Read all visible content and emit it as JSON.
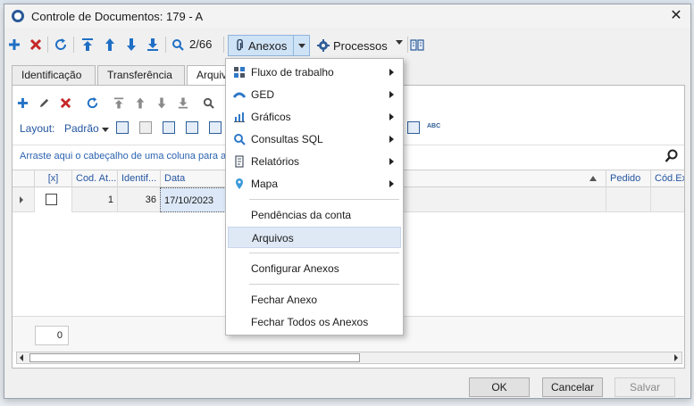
{
  "window": {
    "title": "Controle de Documentos: 179 - A",
    "close_glyph": "✕"
  },
  "toolbar": {
    "record_position": "2/66",
    "anexos_label": "Anexos",
    "processos_label": "Processos",
    "icons": [
      "add-icon",
      "delete-icon",
      "refresh-icon",
      "first-icon",
      "previous-icon",
      "next-icon",
      "last-icon",
      "search-icon",
      "paperclip-icon",
      "gear-icon",
      "book-icon"
    ]
  },
  "tabs": [
    {
      "label": "Identificação"
    },
    {
      "label": "Transferência"
    },
    {
      "label": "Arquivos",
      "visible_text": "Arquiv"
    }
  ],
  "panel": {
    "layout_label": "Layout:",
    "layout_value": "Padrão",
    "group_hint": "Arraste aqui o cabeçalho de uma coluna para agr",
    "columns": [
      "[x]",
      "Cod. At...",
      "Identif...",
      "Data",
      "Pedido",
      "Cód.Ex"
    ],
    "rows": [
      {
        "checked": false,
        "cod_at": "1",
        "identif": "36",
        "data": "17/10/2023"
      }
    ],
    "footer_count": "0"
  },
  "menu": {
    "items": [
      {
        "label": "Fluxo de trabalho",
        "icon": "workflow-icon",
        "submenu": true
      },
      {
        "label": "GED",
        "icon": "ged-icon",
        "submenu": true
      },
      {
        "label": "Gráficos",
        "icon": "chart-icon",
        "submenu": true
      },
      {
        "label": "Consultas SQL",
        "icon": "query-icon",
        "submenu": true
      },
      {
        "label": "Relatórios",
        "icon": "report-icon",
        "submenu": true
      },
      {
        "label": "Mapa",
        "icon": "map-pin-icon",
        "submenu": true
      },
      {
        "label": "Pendências da conta",
        "submenu": false
      },
      {
        "label": "Arquivos",
        "submenu": false,
        "highlighted": true
      },
      {
        "label": "Configurar Anexos",
        "submenu": false
      },
      {
        "label": "Fechar Anexo",
        "submenu": false
      },
      {
        "label": "Fechar Todos os Anexos",
        "submenu": false
      }
    ]
  },
  "buttons": {
    "ok": "OK",
    "cancel": "Cancelar",
    "save": "Salvar"
  },
  "colors": {
    "accent": "#2455a0",
    "menu_highlight": "#dfe8f5",
    "delete_red": "#c62828"
  }
}
